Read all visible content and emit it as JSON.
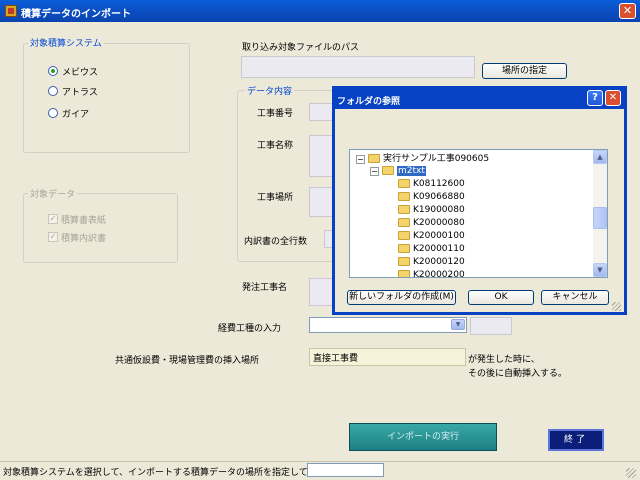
{
  "window": {
    "title": "積算データのインポート",
    "close_glyph": "✕"
  },
  "system_group": {
    "legend": "対象積算システム",
    "options": [
      {
        "label": "メビウス",
        "selected": true
      },
      {
        "label": "アトラス",
        "selected": false
      },
      {
        "label": "ガイア",
        "selected": false
      }
    ]
  },
  "data_group": {
    "legend": "対象データ",
    "items": [
      {
        "label": "積算書表紙",
        "checked": true
      },
      {
        "label": "積算内訳書",
        "checked": true
      }
    ]
  },
  "file_path": {
    "label": "取り込み対象ファイルのパス",
    "value": "",
    "button": "場所の指定"
  },
  "data_content": {
    "legend": "データ内容",
    "fields": {
      "koji_bango": "工事番号",
      "koji_meisho": "工事名称",
      "koji_basho": "工事場所",
      "row_count": "内訳書の全行数"
    }
  },
  "order_name": {
    "label": "発注工事名"
  },
  "expense_rate": {
    "label": "経費工種の入力",
    "value": ""
  },
  "insert_location": {
    "label": "共通仮設費・現場管理費の挿入場所",
    "value": "直接工事費",
    "note_line1": "が発生した時に、",
    "note_line2": "その後に自動挿入する。"
  },
  "buttons": {
    "import": "インポートの実行",
    "end": "終了"
  },
  "status": {
    "text": "対象積算システムを選択して、インポートする積算データの場所を指定して下さい。",
    "field": ""
  },
  "folder_dialog": {
    "title": "フォルダの参照",
    "help_glyph": "?",
    "close_glyph": "✕",
    "tree": {
      "root": "実行サンプル工事090605",
      "selected": "m2txt",
      "children": [
        "K08112600",
        "K09066880",
        "K19000080",
        "K20000080",
        "K20000100",
        "K20000110",
        "K20000120",
        "K20000200"
      ]
    },
    "buttons": {
      "new_folder": "新しいフォルダの作成(M)",
      "ok": "OK",
      "cancel": "キャンセル"
    }
  },
  "colors": {
    "title_bar": "#0b4fc4",
    "group_legend": "#0046d5",
    "import_button": "#1f7f84",
    "end_button": "#0b1f7a"
  }
}
